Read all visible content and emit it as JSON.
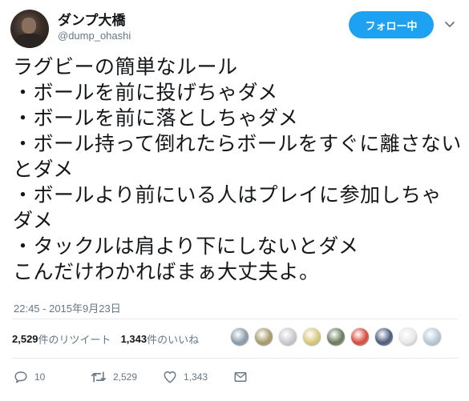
{
  "user": {
    "display_name": "ダンプ大橋",
    "username": "@dump_ohashi"
  },
  "follow_button": {
    "label": "フォロー中"
  },
  "tweet": {
    "text": "ラグビーの簡単なルール\n・ボールを前に投げちゃダメ\n・ボールを前に落としちゃダメ\n・ボール持って倒れたらボールをすぐに離さないとダメ\n・ボールより前にいる人はプレイに参加しちゃダメ\n・タックルは肩より下にしないとダメ\nこんだけわかればまぁ大丈夫よ。",
    "timestamp": "22:45 - 2015年9月23日"
  },
  "stats": {
    "retweets_count": "2,529",
    "retweets_label": "件のリツイート",
    "likes_count": "1,343",
    "likes_label": "件のいいね"
  },
  "liker_avatars": [
    {
      "color": "#8a9aa8"
    },
    {
      "color": "#a89a6a"
    },
    {
      "color": "#c9c9c9"
    },
    {
      "color": "#d8c87a"
    },
    {
      "color": "#6a7a5a"
    },
    {
      "color": "#d84a3a"
    },
    {
      "color": "#4a5a7a"
    },
    {
      "color": "#e8e8e8"
    },
    {
      "color": "#b8c8d8"
    }
  ],
  "actions": {
    "reply_count": "10",
    "retweet_count": "2,529",
    "like_count": "1,343"
  },
  "icons": {
    "caret": "chevron-down-icon",
    "reply": "reply-icon",
    "retweet": "retweet-icon",
    "like": "heart-icon",
    "message": "envelope-icon"
  },
  "colors": {
    "accent": "#1da1f2",
    "text": "#14171a",
    "muted": "#657786"
  }
}
